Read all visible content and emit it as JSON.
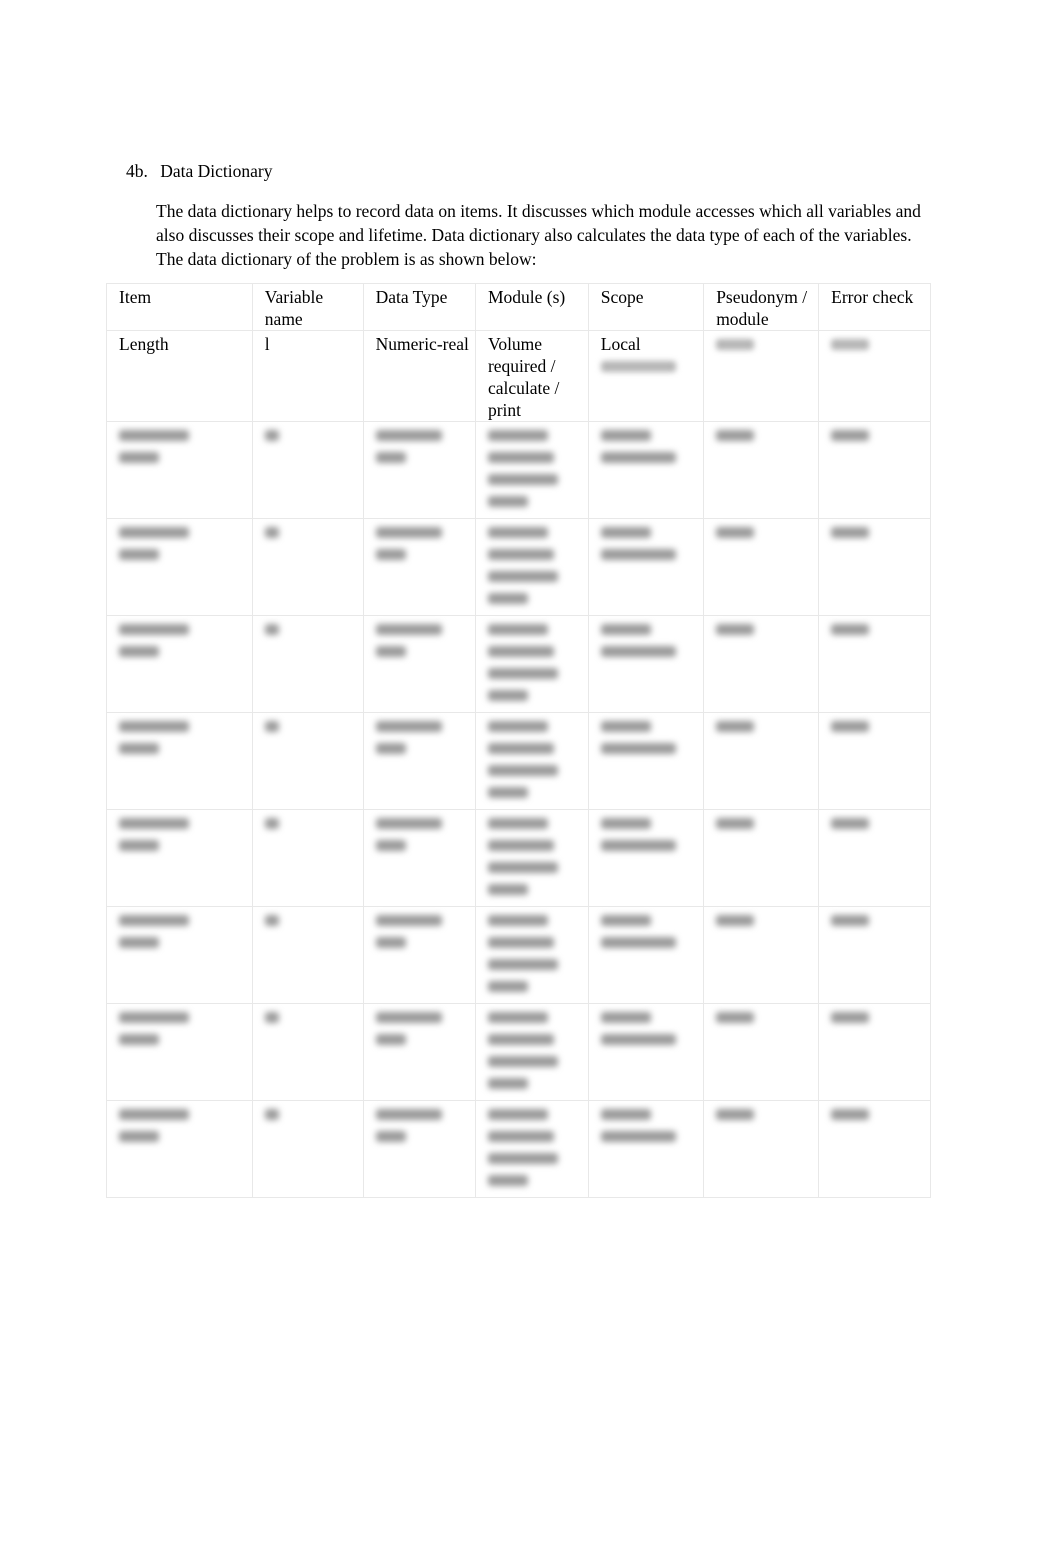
{
  "section": {
    "number": "4b.",
    "title": "Data Dictionary"
  },
  "paragraph": "The data dictionary helps to record data on items. It discusses which module accesses which all variables and also discusses their scope and lifetime. Data dictionary also calculates the data type of each of the variables. The data dictionary of the problem is as shown below:",
  "table": {
    "headers": [
      "Item",
      "Variable name",
      "Data Type",
      "Module (s)",
      "Scope",
      "Pseudonym / module",
      "Error check"
    ],
    "visible_row": {
      "item": "Length",
      "variable": "l",
      "data_type": "Numeric-real",
      "module": "Volume required / calculate / print",
      "scope": "Local"
    },
    "blurred_row_count": 8,
    "obscured_note": "Remaining cell contents are blurred and unreadable"
  }
}
